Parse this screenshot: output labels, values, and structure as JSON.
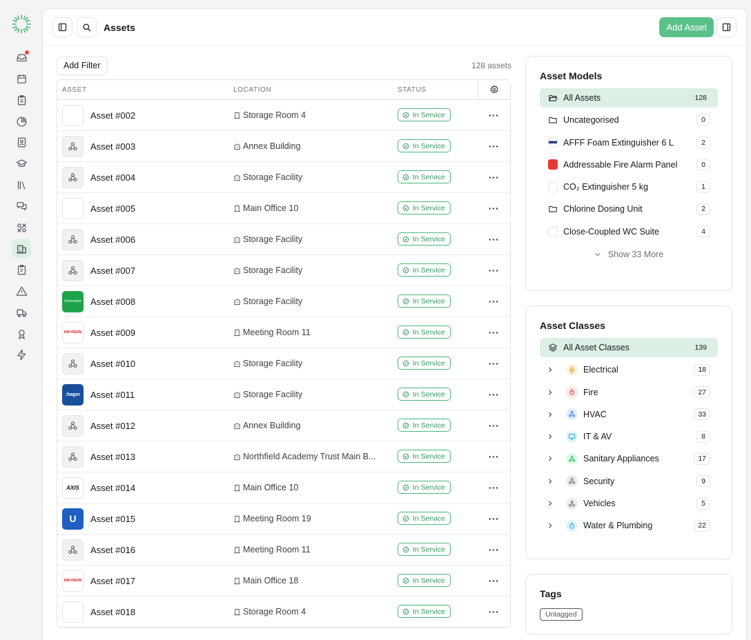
{
  "header": {
    "title": "Assets",
    "add_asset_label": "Add Asset"
  },
  "sidebar": {
    "icons": [
      "inbox-icon",
      "calendar-icon",
      "clipboard-icon",
      "pie-chart-icon",
      "contacts-icon",
      "graduation-cap-icon",
      "library-icon",
      "chat-icon",
      "tools-icon",
      "building-icon",
      "checklist-icon",
      "warning-icon",
      "truck-icon",
      "award-icon",
      "lightning-icon"
    ],
    "active": "building-icon",
    "notification_on": "inbox-icon"
  },
  "filters": {
    "add_filter_label": "Add Filter",
    "count_label": "128 assets"
  },
  "table": {
    "columns": {
      "asset": "ASSET",
      "location": "LOCATION",
      "status": "STATUS"
    },
    "rows": [
      {
        "name": "Asset #002",
        "thumb": "blank",
        "location": "Storage Room 4",
        "loc_icon": "door-icon",
        "status": "In Service"
      },
      {
        "name": "Asset #003",
        "thumb": "model",
        "location": "Annex Building",
        "loc_icon": "building-icon",
        "status": "In Service"
      },
      {
        "name": "Asset #004",
        "thumb": "model",
        "location": "Storage Facility",
        "loc_icon": "building-icon",
        "status": "In Service"
      },
      {
        "name": "Asset #005",
        "thumb": "blank",
        "location": "Main Office 10",
        "loc_icon": "door-icon",
        "status": "In Service"
      },
      {
        "name": "Asset #006",
        "thumb": "model",
        "location": "Storage Facility",
        "loc_icon": "building-icon",
        "status": "In Service"
      },
      {
        "name": "Asset #007",
        "thumb": "model",
        "location": "Storage Facility",
        "loc_icon": "building-icon",
        "status": "In Service"
      },
      {
        "name": "Asset #008",
        "thumb": "schneider",
        "location": "Storage Facility",
        "loc_icon": "building-icon",
        "status": "In Service"
      },
      {
        "name": "Asset #009",
        "thumb": "hik",
        "location": "Meeting Room 11",
        "loc_icon": "door-icon",
        "status": "In Service"
      },
      {
        "name": "Asset #010",
        "thumb": "model",
        "location": "Storage Facility",
        "loc_icon": "building-icon",
        "status": "In Service"
      },
      {
        "name": "Asset #011",
        "thumb": "hager",
        "location": "Storage Facility",
        "loc_icon": "building-icon",
        "status": "In Service"
      },
      {
        "name": "Asset #012",
        "thumb": "model",
        "location": "Annex Building",
        "loc_icon": "building-icon",
        "status": "In Service"
      },
      {
        "name": "Asset #013",
        "thumb": "model",
        "location": "Northfield Academy Trust Main B...",
        "loc_icon": "building-icon",
        "status": "In Service"
      },
      {
        "name": "Asset #014",
        "thumb": "axis",
        "location": "Main Office 10",
        "loc_icon": "door-icon",
        "status": "In Service"
      },
      {
        "name": "Asset #015",
        "thumb": "ubi",
        "location": "Meeting Room 19",
        "loc_icon": "door-icon",
        "status": "In Service"
      },
      {
        "name": "Asset #016",
        "thumb": "model",
        "location": "Meeting Room 11",
        "loc_icon": "door-icon",
        "status": "In Service"
      },
      {
        "name": "Asset #017",
        "thumb": "hik",
        "location": "Main Office 18",
        "loc_icon": "door-icon",
        "status": "In Service"
      },
      {
        "name": "Asset #018",
        "thumb": "blank",
        "location": "Storage Room 4",
        "loc_icon": "door-icon",
        "status": "In Service"
      }
    ]
  },
  "asset_models": {
    "title": "Asset Models",
    "items": [
      {
        "label": "All Assets",
        "count": "128",
        "icon": "folder-open-icon",
        "selected": true
      },
      {
        "label": "Uncategorised",
        "count": "0",
        "icon": "folder-icon"
      },
      {
        "label": "AFFF Foam Extinguisher 6 L",
        "count": "2",
        "icon": "model-image"
      },
      {
        "label": "Addressable Fire Alarm Panel",
        "count": "0",
        "icon": "model-image-red"
      },
      {
        "label": "CO₂ Extinguisher 5 kg",
        "count": "1",
        "icon": "model-image-blank"
      },
      {
        "label": "Chlorine Dosing Unit",
        "count": "2",
        "icon": "folder-icon"
      },
      {
        "label": "Close-Coupled WC Suite",
        "count": "4",
        "icon": "model-image-blank"
      }
    ],
    "show_more": "Show 33 More"
  },
  "asset_classes": {
    "title": "Asset Classes",
    "all": {
      "label": "All Asset Classes",
      "count": "139"
    },
    "items": [
      {
        "label": "Electrical",
        "count": "18",
        "icon": "lightning-icon",
        "color": "#f59e0b"
      },
      {
        "label": "Fire",
        "count": "27",
        "icon": "flame-icon",
        "color": "#ef4444"
      },
      {
        "label": "HVAC",
        "count": "33",
        "icon": "network-icon",
        "color": "#3b82f6"
      },
      {
        "label": "IT & AV",
        "count": "8",
        "icon": "monitor-icon",
        "color": "#0ea5e9"
      },
      {
        "label": "Sanitary Appliances",
        "count": "17",
        "icon": "network-icon",
        "color": "#22c55e"
      },
      {
        "label": "Security",
        "count": "9",
        "icon": "network-icon",
        "color": "#71717a"
      },
      {
        "label": "Vehicles",
        "count": "5",
        "icon": "network-icon",
        "color": "#71717a"
      },
      {
        "label": "Water & Plumbing",
        "count": "22",
        "icon": "droplet-icon",
        "color": "#0ea5e9"
      }
    ]
  },
  "tags": {
    "title": "Tags",
    "items": [
      "Untagged"
    ]
  },
  "colors": {
    "accent": "#5cc189",
    "selected_bg": "#dcefe4",
    "badge": "#2f9a5e"
  }
}
